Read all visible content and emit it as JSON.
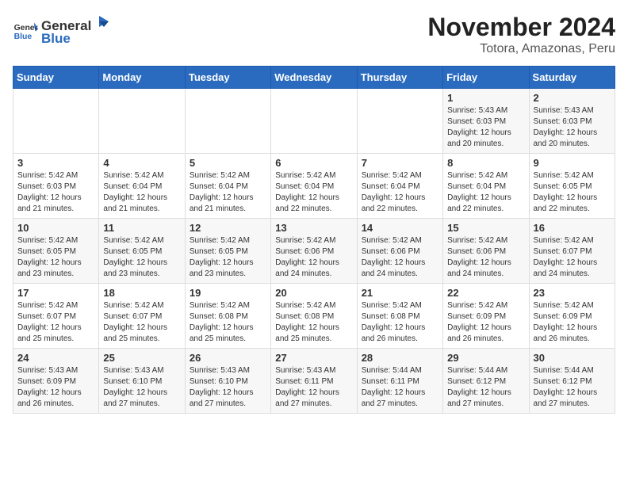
{
  "header": {
    "logo_general": "General",
    "logo_blue": "Blue",
    "title": "November 2024",
    "subtitle": "Totora, Amazonas, Peru"
  },
  "calendar": {
    "weekdays": [
      "Sunday",
      "Monday",
      "Tuesday",
      "Wednesday",
      "Thursday",
      "Friday",
      "Saturday"
    ],
    "weeks": [
      [
        {
          "day": "",
          "info": ""
        },
        {
          "day": "",
          "info": ""
        },
        {
          "day": "",
          "info": ""
        },
        {
          "day": "",
          "info": ""
        },
        {
          "day": "",
          "info": ""
        },
        {
          "day": "1",
          "info": "Sunrise: 5:43 AM\nSunset: 6:03 PM\nDaylight: 12 hours and 20 minutes."
        },
        {
          "day": "2",
          "info": "Sunrise: 5:43 AM\nSunset: 6:03 PM\nDaylight: 12 hours and 20 minutes."
        }
      ],
      [
        {
          "day": "3",
          "info": "Sunrise: 5:42 AM\nSunset: 6:03 PM\nDaylight: 12 hours and 21 minutes."
        },
        {
          "day": "4",
          "info": "Sunrise: 5:42 AM\nSunset: 6:04 PM\nDaylight: 12 hours and 21 minutes."
        },
        {
          "day": "5",
          "info": "Sunrise: 5:42 AM\nSunset: 6:04 PM\nDaylight: 12 hours and 21 minutes."
        },
        {
          "day": "6",
          "info": "Sunrise: 5:42 AM\nSunset: 6:04 PM\nDaylight: 12 hours and 22 minutes."
        },
        {
          "day": "7",
          "info": "Sunrise: 5:42 AM\nSunset: 6:04 PM\nDaylight: 12 hours and 22 minutes."
        },
        {
          "day": "8",
          "info": "Sunrise: 5:42 AM\nSunset: 6:04 PM\nDaylight: 12 hours and 22 minutes."
        },
        {
          "day": "9",
          "info": "Sunrise: 5:42 AM\nSunset: 6:05 PM\nDaylight: 12 hours and 22 minutes."
        }
      ],
      [
        {
          "day": "10",
          "info": "Sunrise: 5:42 AM\nSunset: 6:05 PM\nDaylight: 12 hours and 23 minutes."
        },
        {
          "day": "11",
          "info": "Sunrise: 5:42 AM\nSunset: 6:05 PM\nDaylight: 12 hours and 23 minutes."
        },
        {
          "day": "12",
          "info": "Sunrise: 5:42 AM\nSunset: 6:05 PM\nDaylight: 12 hours and 23 minutes."
        },
        {
          "day": "13",
          "info": "Sunrise: 5:42 AM\nSunset: 6:06 PM\nDaylight: 12 hours and 24 minutes."
        },
        {
          "day": "14",
          "info": "Sunrise: 5:42 AM\nSunset: 6:06 PM\nDaylight: 12 hours and 24 minutes."
        },
        {
          "day": "15",
          "info": "Sunrise: 5:42 AM\nSunset: 6:06 PM\nDaylight: 12 hours and 24 minutes."
        },
        {
          "day": "16",
          "info": "Sunrise: 5:42 AM\nSunset: 6:07 PM\nDaylight: 12 hours and 24 minutes."
        }
      ],
      [
        {
          "day": "17",
          "info": "Sunrise: 5:42 AM\nSunset: 6:07 PM\nDaylight: 12 hours and 25 minutes."
        },
        {
          "day": "18",
          "info": "Sunrise: 5:42 AM\nSunset: 6:07 PM\nDaylight: 12 hours and 25 minutes."
        },
        {
          "day": "19",
          "info": "Sunrise: 5:42 AM\nSunset: 6:08 PM\nDaylight: 12 hours and 25 minutes."
        },
        {
          "day": "20",
          "info": "Sunrise: 5:42 AM\nSunset: 6:08 PM\nDaylight: 12 hours and 25 minutes."
        },
        {
          "day": "21",
          "info": "Sunrise: 5:42 AM\nSunset: 6:08 PM\nDaylight: 12 hours and 26 minutes."
        },
        {
          "day": "22",
          "info": "Sunrise: 5:42 AM\nSunset: 6:09 PM\nDaylight: 12 hours and 26 minutes."
        },
        {
          "day": "23",
          "info": "Sunrise: 5:42 AM\nSunset: 6:09 PM\nDaylight: 12 hours and 26 minutes."
        }
      ],
      [
        {
          "day": "24",
          "info": "Sunrise: 5:43 AM\nSunset: 6:09 PM\nDaylight: 12 hours and 26 minutes."
        },
        {
          "day": "25",
          "info": "Sunrise: 5:43 AM\nSunset: 6:10 PM\nDaylight: 12 hours and 27 minutes."
        },
        {
          "day": "26",
          "info": "Sunrise: 5:43 AM\nSunset: 6:10 PM\nDaylight: 12 hours and 27 minutes."
        },
        {
          "day": "27",
          "info": "Sunrise: 5:43 AM\nSunset: 6:11 PM\nDaylight: 12 hours and 27 minutes."
        },
        {
          "day": "28",
          "info": "Sunrise: 5:44 AM\nSunset: 6:11 PM\nDaylight: 12 hours and 27 minutes."
        },
        {
          "day": "29",
          "info": "Sunrise: 5:44 AM\nSunset: 6:12 PM\nDaylight: 12 hours and 27 minutes."
        },
        {
          "day": "30",
          "info": "Sunrise: 5:44 AM\nSunset: 6:12 PM\nDaylight: 12 hours and 27 minutes."
        }
      ]
    ]
  }
}
